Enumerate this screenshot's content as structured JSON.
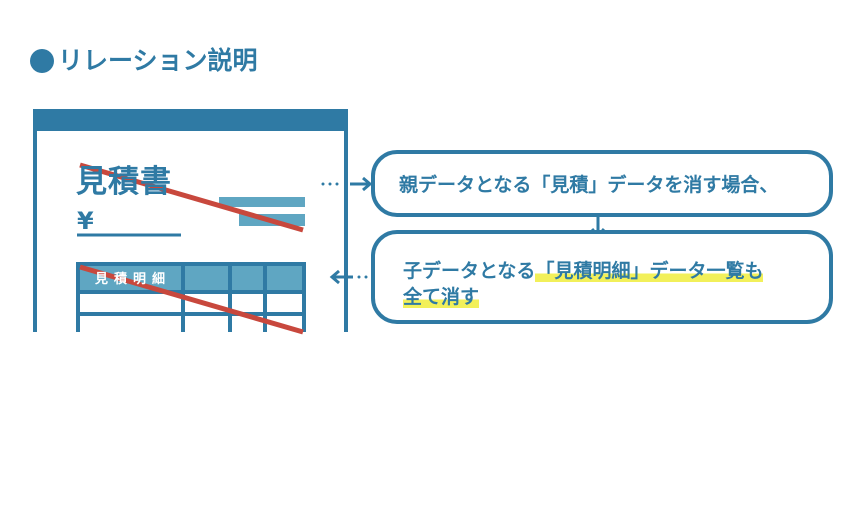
{
  "heading": {
    "text": "リレーション説明"
  },
  "document": {
    "title": "見積書",
    "currency_symbol": "¥",
    "table_header": "見積明細"
  },
  "bubbles": {
    "parent": {
      "text": "親データとなる「見積」データを消す場合、"
    },
    "child": {
      "line1_plain": "子データとなる",
      "line1_highlight": "「見積明細」データ一覧も",
      "line2_highlight": "全て消す"
    }
  },
  "colors": {
    "primary": "#2f7aa4",
    "light": "#5fa6c2",
    "strike": "#c8483d",
    "highlight": "#f2f05a"
  }
}
